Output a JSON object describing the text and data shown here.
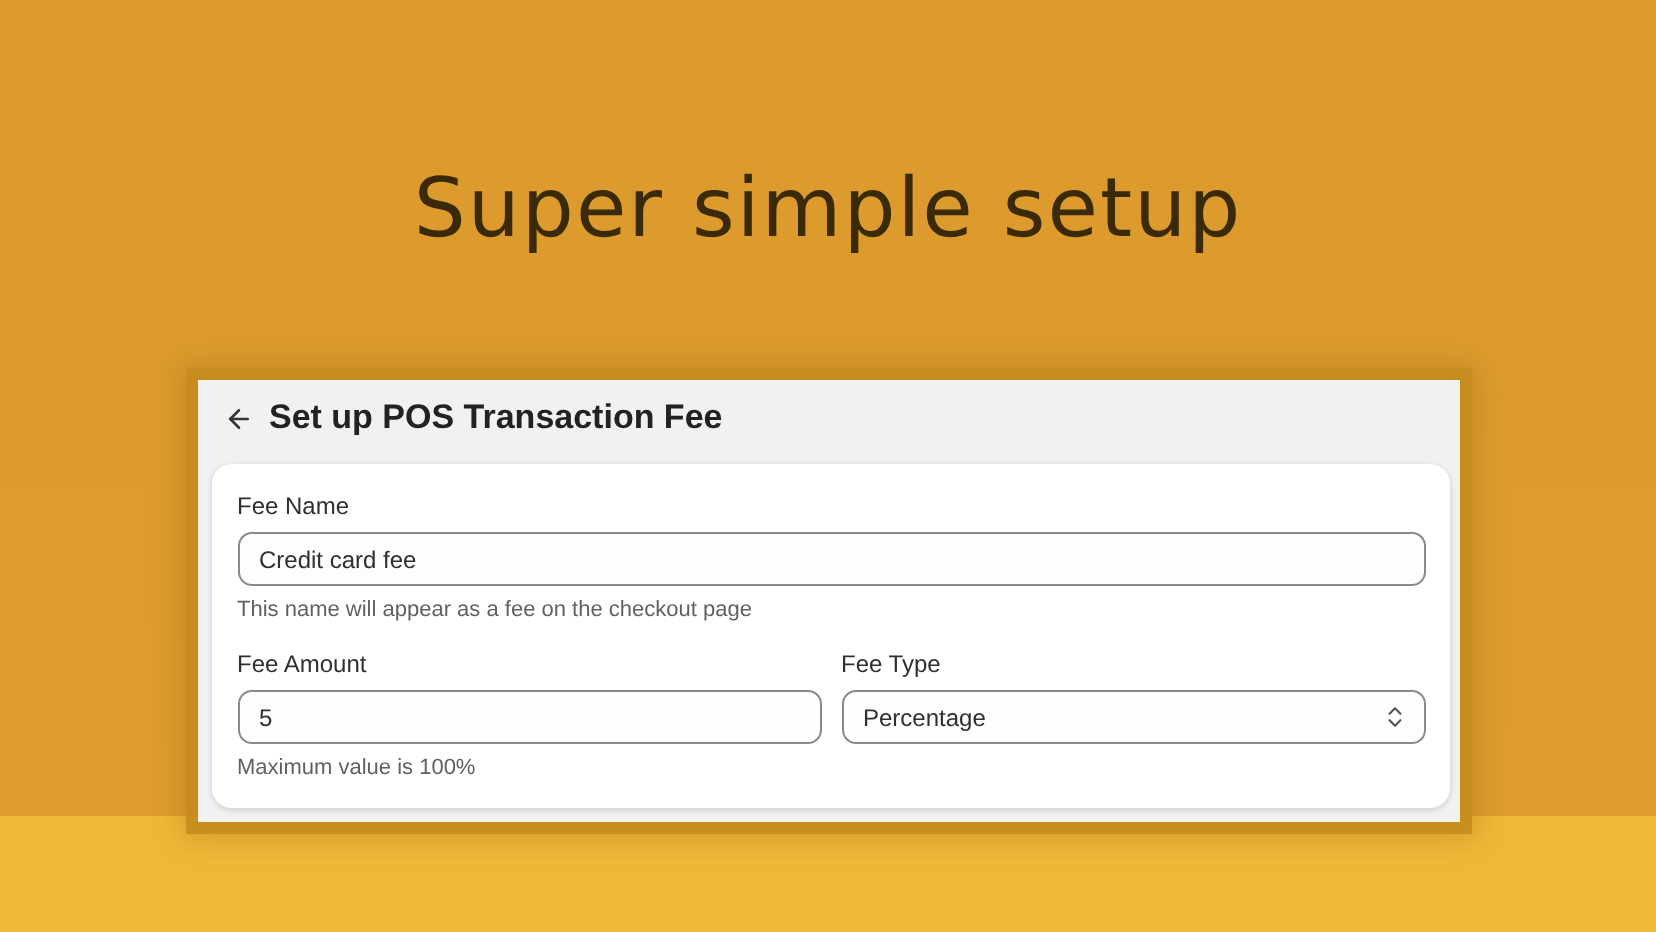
{
  "headline": "Super simple setup",
  "screen": {
    "title": "Set up POS Transaction Fee",
    "fields": [
      {
        "kind": "text",
        "label": "Fee Name",
        "value": "Credit card fee",
        "help": "This name will appear as a fee on the checkout page"
      }
    ],
    "row": [
      {
        "kind": "text",
        "label": "Fee Amount",
        "value": "5",
        "help": "Maximum value is 100%"
      },
      {
        "kind": "select",
        "label": "Fee Type",
        "value": "Percentage"
      }
    ]
  }
}
